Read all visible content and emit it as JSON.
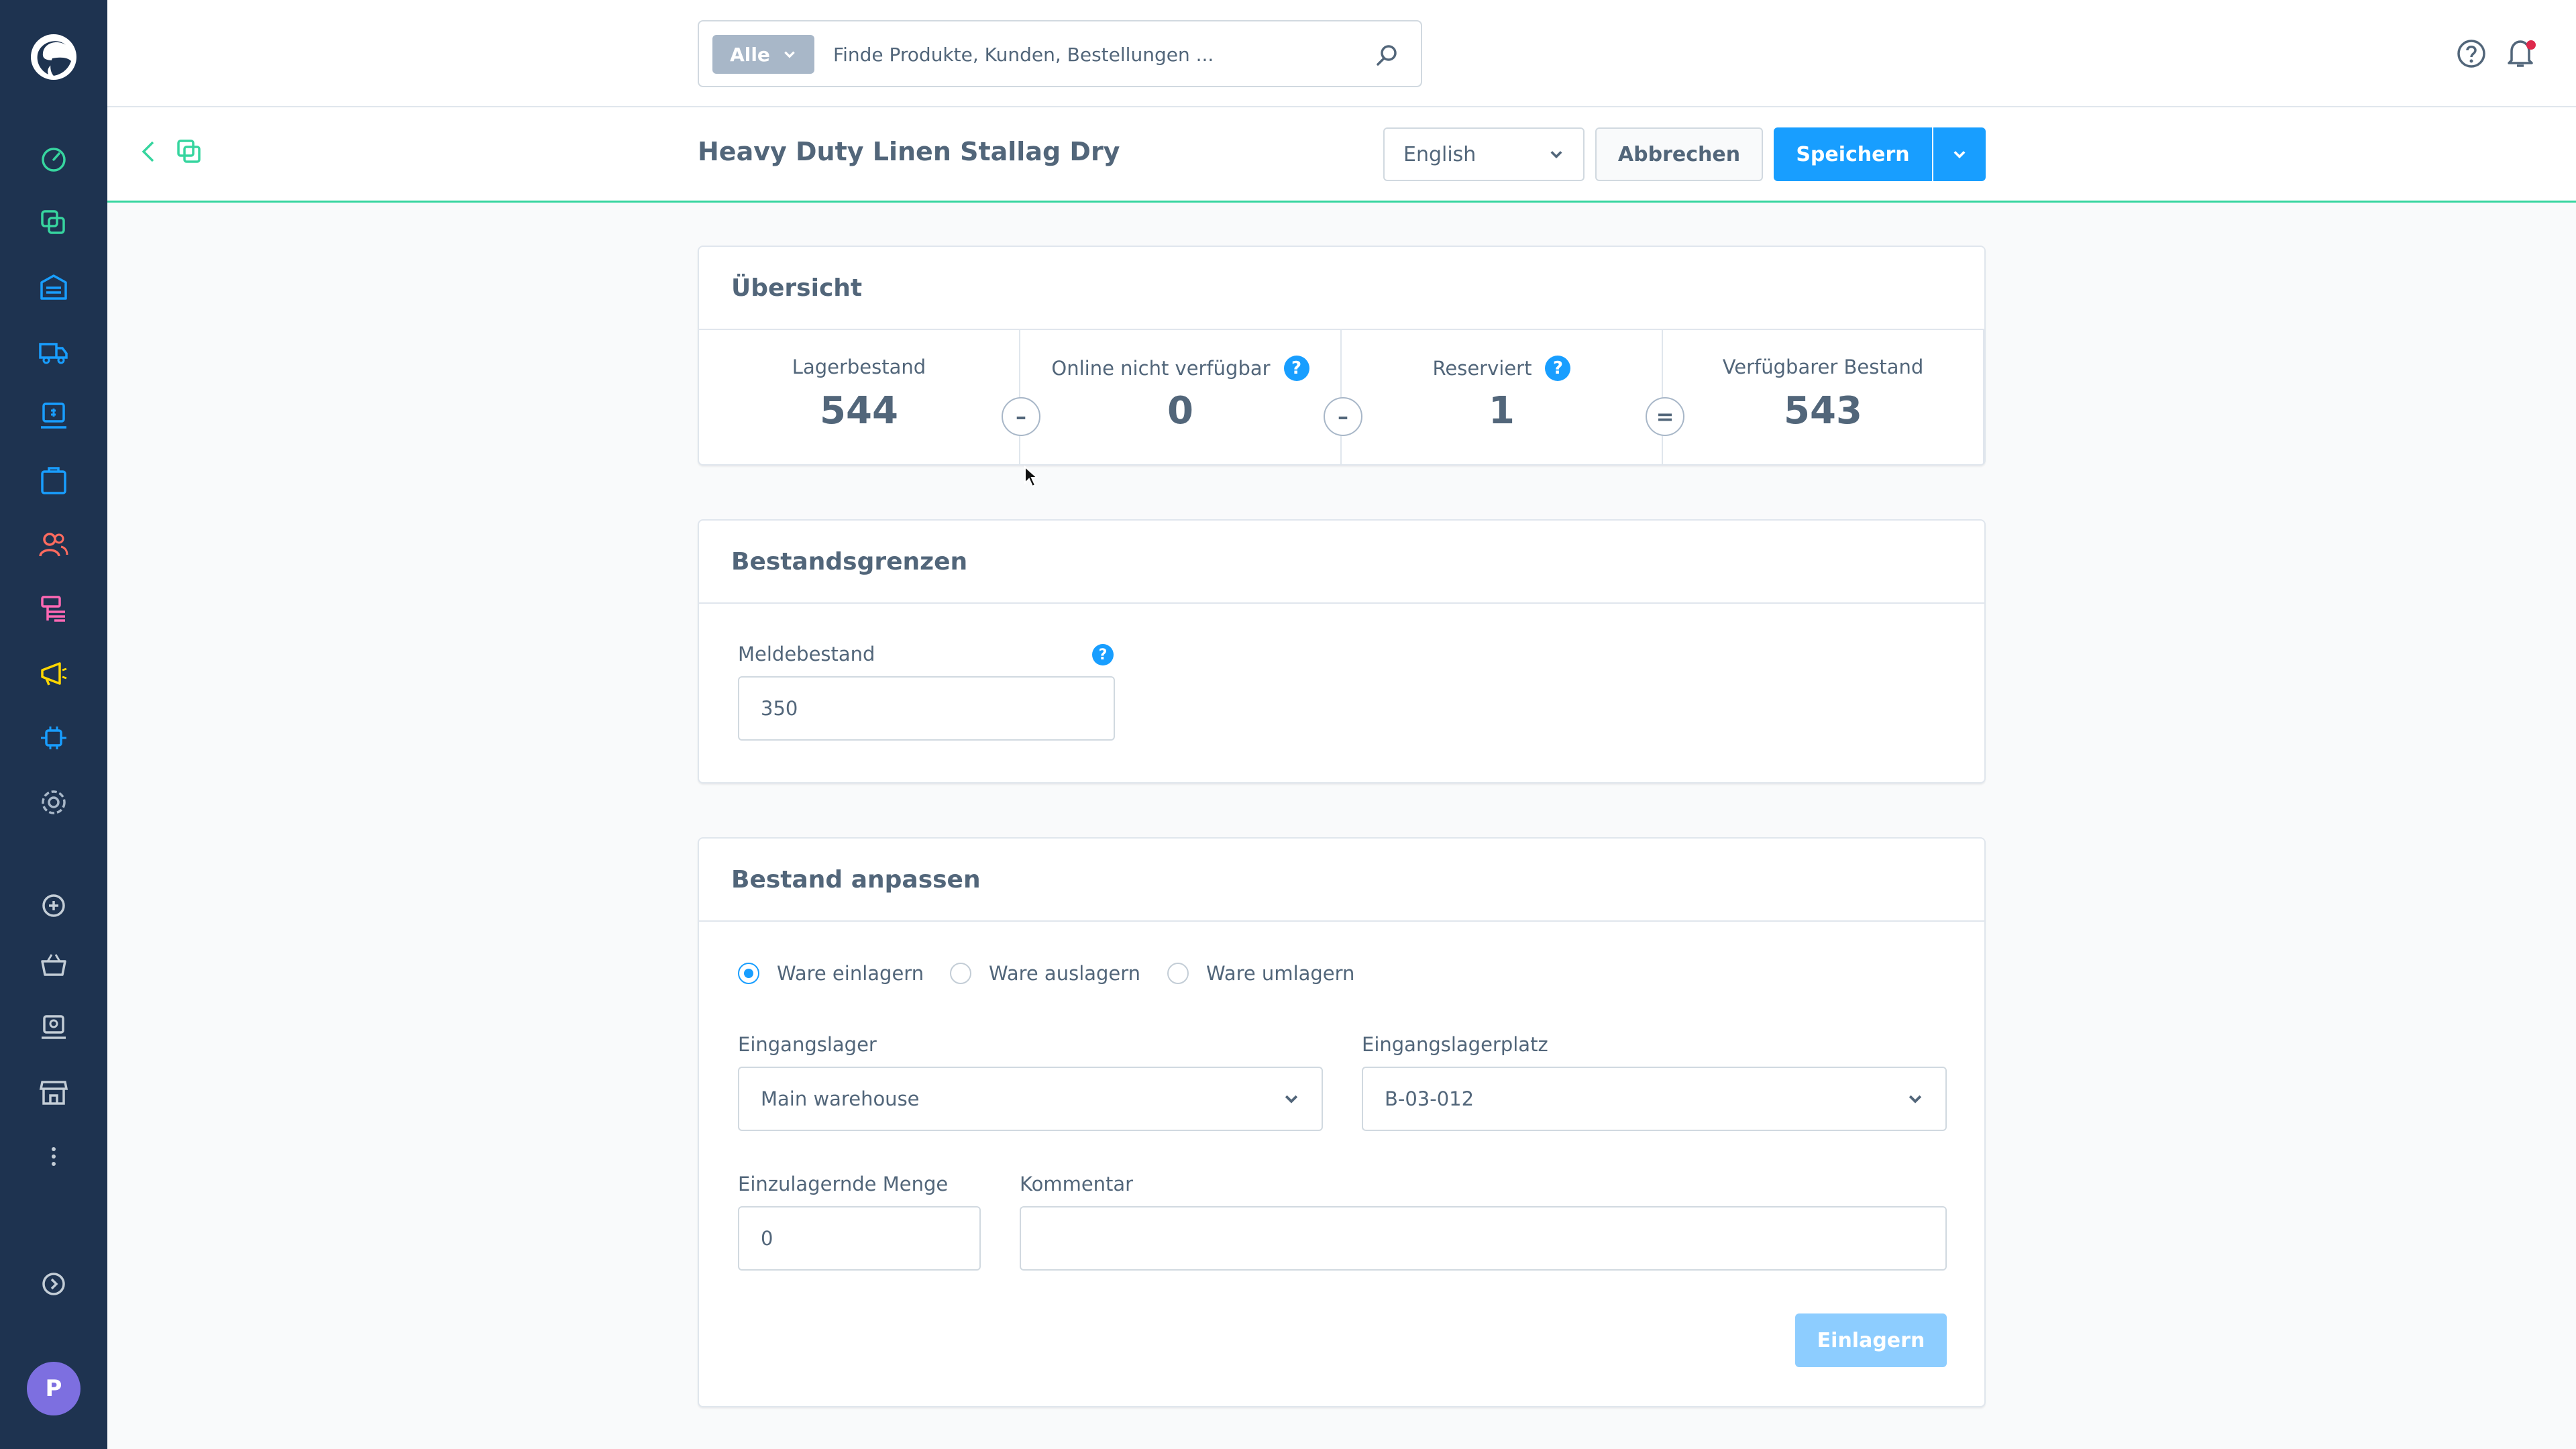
{
  "sidebar": {
    "items": [
      "dashboard-icon",
      "catalogue-icon",
      "warehouse-icon",
      "delivery-icon",
      "pos-icon",
      "orders-icon",
      "customers-icon",
      "content-icon",
      "marketing-icon",
      "extensions-icon",
      "settings-icon"
    ],
    "quick_actions": [
      "add-icon",
      "basket-icon",
      "register-icon",
      "store-icon",
      "more-icon"
    ],
    "user_initial": "P"
  },
  "search": {
    "scope_label": "Alle",
    "placeholder": "Finde Produkte, Kunden, Bestellungen ..."
  },
  "header": {
    "title": "Heavy Duty Linen Stallag Dry",
    "language": "English",
    "cancel_label": "Abbrechen",
    "save_label": "Speichern"
  },
  "overview": {
    "title": "Übersicht",
    "stock_label": "Lagerbestand",
    "stock_value": "544",
    "unavailable_label": "Online nicht verfügbar",
    "unavailable_value": "0",
    "reserved_label": "Reserviert",
    "reserved_value": "1",
    "available_label": "Verfügbarer Bestand",
    "available_value": "543",
    "op_minus": "–",
    "op_equals": "="
  },
  "limits": {
    "title": "Bestandsgrenzen",
    "reorder_label": "Meldebestand",
    "reorder_value": "350"
  },
  "adjust": {
    "title": "Bestand anpassen",
    "radio_in": "Ware einlagern",
    "radio_out": "Ware auslagern",
    "radio_move": "Ware umlagern",
    "warehouse_label": "Eingangslager",
    "warehouse_value": "Main warehouse",
    "bin_label": "Eingangslagerplatz",
    "bin_value": "B-03-012",
    "quantity_label": "Einzulagernde Menge",
    "quantity_value": "0",
    "comment_label": "Kommentar",
    "comment_value": "",
    "submit_label": "Einlagern"
  },
  "colors": {
    "sidebar": "#1e3350",
    "primary": "#189eff",
    "accent_green": "#37d59f",
    "text": "#52667a"
  }
}
